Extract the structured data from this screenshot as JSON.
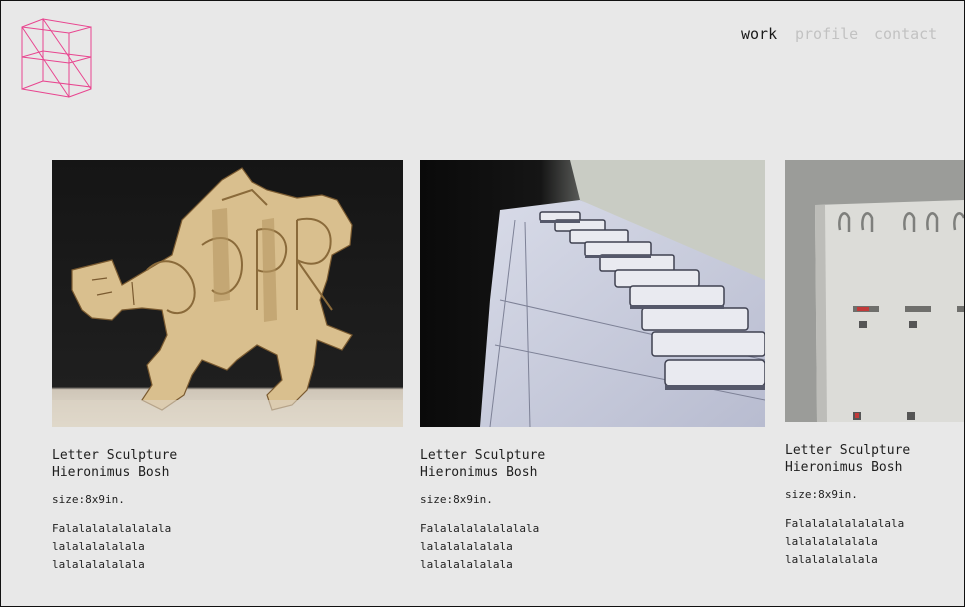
{
  "brand": {
    "logo_icon": "wireframe-n-logo-icon",
    "logo_color": "#e8458f"
  },
  "nav": {
    "items": [
      {
        "label": "work",
        "active": true
      },
      {
        "label": "profile",
        "active": false
      },
      {
        "label": "contact",
        "active": false
      }
    ]
  },
  "works": [
    {
      "image_icon": "letter-sculpture-photo",
      "title": "Letter Sculpture",
      "artist": "Hieronimus Bosh",
      "size": "size:8x9in.",
      "description": [
        "Falalalalalalalala",
        "lalalalalalala",
        "lalalalalalala"
      ]
    },
    {
      "image_icon": "paper-piano-photo",
      "title": "Letter Sculpture",
      "artist": "Hieronimus Bosh",
      "size": "size:8x9in.",
      "description": [
        "Falalalalalalalala",
        "lalalalalalala",
        "lalalalalalala"
      ]
    },
    {
      "image_icon": "spiral-calendar-photo",
      "title": "Letter Sculpture",
      "artist": "Hieronimus Bosh",
      "size": "size:8x9in.",
      "description": [
        "Falalalalalalalala",
        "lalalalalalala",
        "lalalalalalala"
      ]
    }
  ]
}
